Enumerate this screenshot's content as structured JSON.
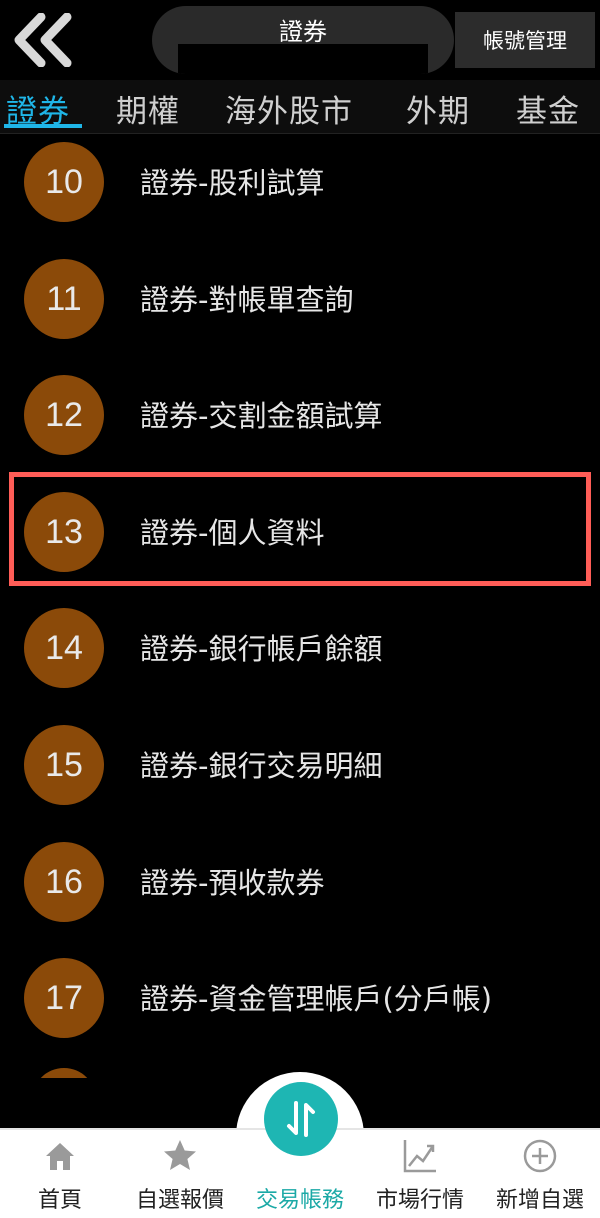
{
  "header": {
    "title": "證券",
    "account_button": "帳號管理"
  },
  "tabs": [
    {
      "label": "證券",
      "active": true
    },
    {
      "label": "期權",
      "active": false
    },
    {
      "label": "海外股市",
      "active": false
    },
    {
      "label": "外期",
      "active": false
    },
    {
      "label": "基金",
      "active": false
    }
  ],
  "menu": {
    "items": [
      {
        "num": "10",
        "label": "證券-股利試算"
      },
      {
        "num": "11",
        "label": "證券-對帳單查詢"
      },
      {
        "num": "12",
        "label": "證券-交割金額試算"
      },
      {
        "num": "13",
        "label": "證券-個人資料",
        "highlighted": true
      },
      {
        "num": "14",
        "label": "證券-銀行帳戶餘額"
      },
      {
        "num": "15",
        "label": "證券-銀行交易明細"
      },
      {
        "num": "16",
        "label": "證券-預收款券"
      },
      {
        "num": "17",
        "label": "證券-資金管理帳戶(分戶帳)"
      }
    ]
  },
  "bottom_nav": [
    {
      "label": "首頁",
      "icon": "home-icon"
    },
    {
      "label": "自選報價",
      "icon": "star-icon"
    },
    {
      "label": "交易帳務",
      "icon": "swap-arrows-icon",
      "active": true
    },
    {
      "label": "市場行情",
      "icon": "chart-trend-icon"
    },
    {
      "label": "新增自選",
      "icon": "plus-circle-icon"
    }
  ],
  "colors": {
    "accent": "#1fb6e8",
    "badge": "#8b4a09",
    "highlight": "#ff5d57",
    "nav_active": "#1ba9a6"
  }
}
